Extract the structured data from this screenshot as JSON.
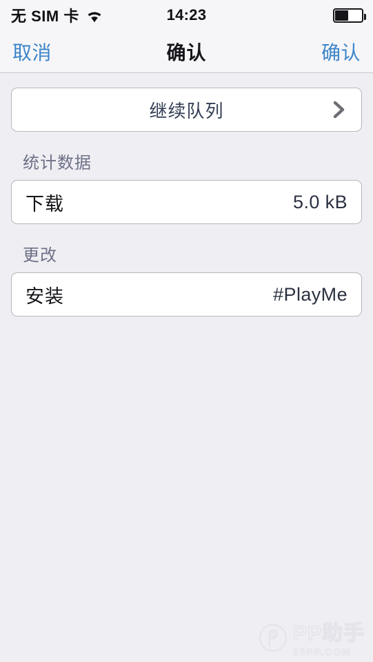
{
  "status_bar": {
    "carrier": "无 SIM 卡",
    "wifi_icon": "wifi-icon",
    "time": "14:23",
    "battery_icon": "battery-icon",
    "battery_percent": 50
  },
  "nav_bar": {
    "cancel_label": "取消",
    "title": "确认",
    "confirm_label": "确认",
    "tint_color": "#3c84c9"
  },
  "content": {
    "queue_card": {
      "label": "继续队列",
      "chevron_icon": "chevron-right-icon"
    },
    "sections": [
      {
        "header": "统计数据",
        "rows": [
          {
            "label": "下载",
            "value": "5.0 kB"
          }
        ]
      },
      {
        "header": "更改",
        "rows": [
          {
            "label": "安装",
            "value": "#PlayMe"
          }
        ]
      }
    ]
  },
  "watermark": {
    "title": "PP助手",
    "subtitle": "25PP.COM",
    "logo_icon": "pp-logo-icon"
  },
  "colors": {
    "page_background": "#eeeef3",
    "bar_background": "#f6f6f8",
    "card_background": "#ffffff",
    "card_border": "#b7b7bd",
    "accent_blue": "#3c84c9",
    "section_header": "#6e7187",
    "primary_text": "#141418",
    "value_text": "#2b3140"
  }
}
